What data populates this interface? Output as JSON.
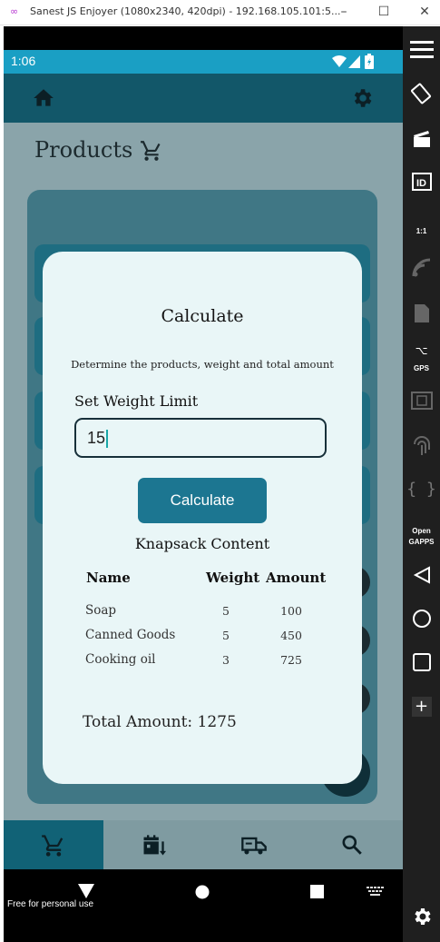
{
  "window": {
    "title": "Sanest JS Enjoyer (1080x2340, 420dpi) - 192.168.105.101:5...",
    "minimize": "–",
    "maximize": "☐",
    "close": "✕"
  },
  "statusbar": {
    "time": "1:06"
  },
  "page": {
    "title": "Products"
  },
  "dialog": {
    "title": "Calculate",
    "subtitle": "Determine the products, weight and total amount",
    "weight_label": "Set Weight Limit",
    "weight_value": "15",
    "calculate_button": "Calculate",
    "knapsack_title": "Knapsack Content",
    "columns": [
      "Name",
      "Weight",
      "Amount"
    ],
    "rows": [
      {
        "name": "Soap",
        "weight": "5",
        "amount": "100"
      },
      {
        "name": "Canned Goods",
        "weight": "5",
        "amount": "450"
      },
      {
        "name": "Cooking oil",
        "weight": "3",
        "amount": "725"
      }
    ],
    "total": "Total Amount: 1275"
  },
  "bottom_nav": {
    "tabs": [
      {
        "icon": "cart-icon",
        "active": true
      },
      {
        "icon": "calendar-sort-icon",
        "active": false
      },
      {
        "icon": "truck-icon",
        "active": false
      },
      {
        "icon": "search-icon",
        "active": false
      }
    ]
  },
  "system": {
    "watermark": "Free for personal use"
  },
  "emulator_sidebar": {
    "gps_label": "GPS",
    "id_label": "ID",
    "ratio_label": "1:1",
    "opengapps_label": "Open GAPPS"
  },
  "colors": {
    "statusbar": "#1a9fc4",
    "appbar": "#125769",
    "dialog_bg": "#e9f6f7",
    "button": "#1c7691",
    "active_tab": "#116276"
  }
}
